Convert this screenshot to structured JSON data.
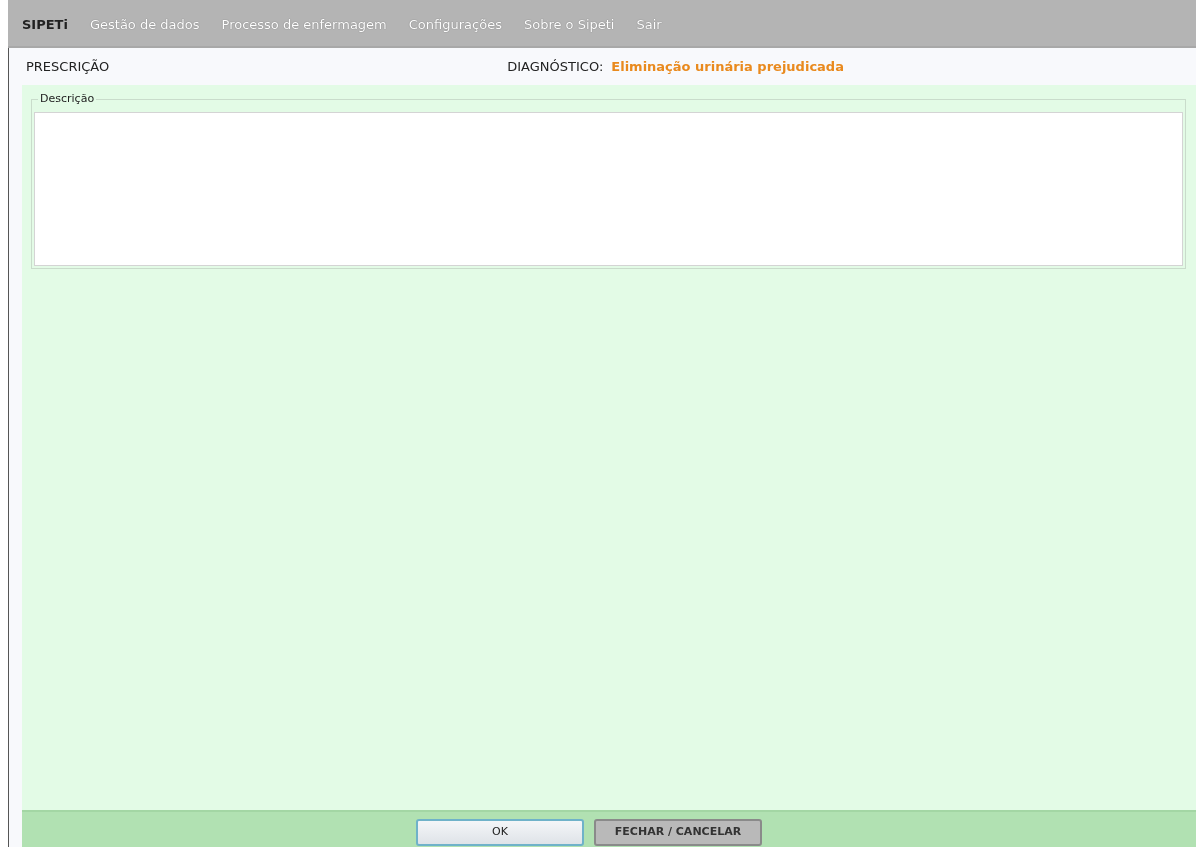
{
  "menu": {
    "brand": "SIPETi",
    "items": [
      {
        "label": "Gestão de dados"
      },
      {
        "label": "Processo de enfermagem"
      },
      {
        "label": "Configurações"
      },
      {
        "label": "Sobre o Sipeti"
      },
      {
        "label": "Sair"
      }
    ]
  },
  "header": {
    "title": "PRESCRIÇÃO",
    "diagnosis_label": "DIAGNÓSTICO:",
    "diagnosis_value": "Eliminação urinária prejudicada"
  },
  "description": {
    "legend": "Descrição"
  },
  "buttons": [
    {
      "label": "OK",
      "kind": "primary"
    },
    {
      "label": "FECHAR / CANCELAR",
      "kind": "secondary"
    }
  ]
}
